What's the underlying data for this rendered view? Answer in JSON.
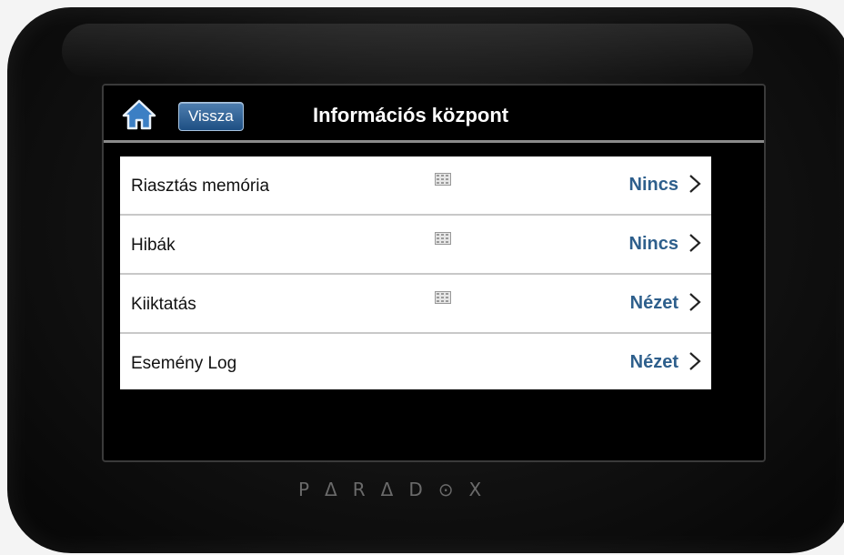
{
  "header": {
    "home_icon": "home-icon",
    "back_label": "Vissza",
    "title": "Információs központ"
  },
  "rows": [
    {
      "label": "Riasztás memória",
      "value": "Nincs",
      "has_keypad_icon": true
    },
    {
      "label": "Hibák",
      "value": "Nincs",
      "has_keypad_icon": true
    },
    {
      "label": "Kiiktatás",
      "value": "Nézet",
      "has_keypad_icon": true
    },
    {
      "label": "Esemény Log",
      "value": "Nézet",
      "has_keypad_icon": false
    }
  ],
  "brand": "PΔRΔD⊙X",
  "colors": {
    "value_text": "#2e5f8c",
    "back_button": "#2a5f94",
    "home_icon": "#3c7fc4"
  }
}
